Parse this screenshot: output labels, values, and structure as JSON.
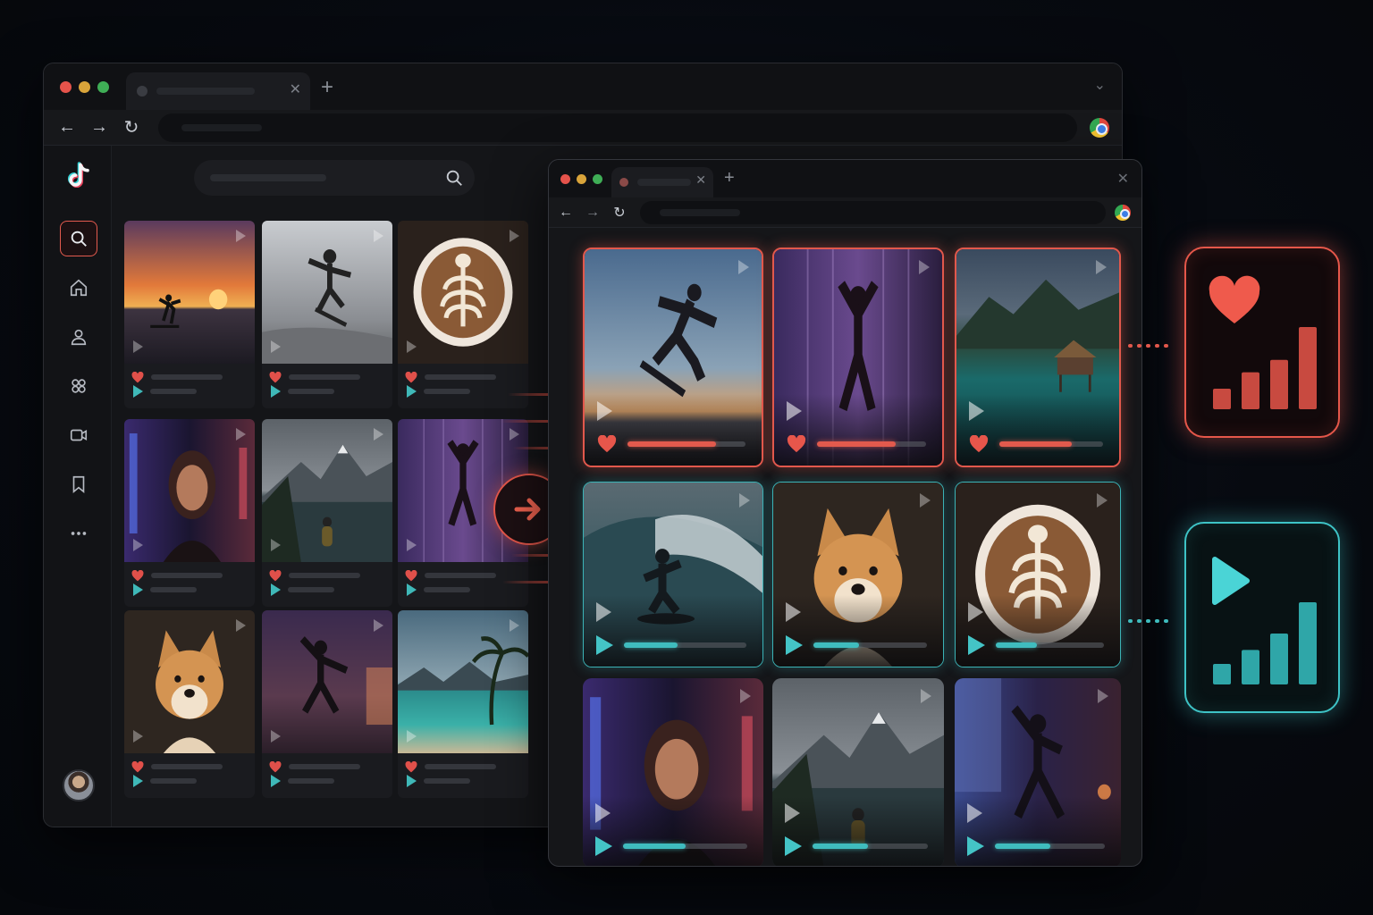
{
  "colors": {
    "accent_red": "#e2584c",
    "accent_teal": "#3fbcbe",
    "background": "#070a10"
  },
  "back_window": {
    "tab": {
      "close_icon": "close-icon",
      "new_tab_icon": "plus-icon"
    },
    "nav": {
      "icons": [
        "back-arrow-icon",
        "forward-arrow-icon",
        "reload-icon",
        "chrome-icon"
      ]
    },
    "app": {
      "logo": "tiktok-logo",
      "sidebar_icons": [
        "search-icon",
        "home-icon",
        "following-icon",
        "friends-icon",
        "live-icon",
        "bookmark-icon",
        "more-icon"
      ],
      "active_sidebar": "search-icon",
      "cards": [
        {
          "subject": "sunset-surfer"
        },
        {
          "subject": "skateboarder"
        },
        {
          "subject": "latte-art"
        },
        {
          "subject": "neon-portrait"
        },
        {
          "subject": "mountain-lake"
        },
        {
          "subject": "dancer-purple"
        },
        {
          "subject": "shiba-dog"
        },
        {
          "subject": "dancer-sunset"
        },
        {
          "subject": "tropical-beach"
        }
      ]
    }
  },
  "front_window": {
    "cards": [
      {
        "subject": "skateboard-jump",
        "style": "red",
        "metric": "likes",
        "progress": 0.75
      },
      {
        "subject": "dancer-purple",
        "style": "red",
        "metric": "likes",
        "progress": 0.72
      },
      {
        "subject": "overwater-bungalow",
        "style": "red",
        "metric": "likes",
        "progress": 0.7
      },
      {
        "subject": "wave-surfer",
        "style": "teal",
        "metric": "plays",
        "progress": 0.44
      },
      {
        "subject": "shiba-dog",
        "style": "teal",
        "metric": "plays",
        "progress": 0.4
      },
      {
        "subject": "latte-art",
        "style": "teal",
        "metric": "plays",
        "progress": 0.38
      },
      {
        "subject": "neon-portrait",
        "style": "plain",
        "metric": "plays",
        "progress": 0.5
      },
      {
        "subject": "mountain-lake",
        "style": "plain",
        "metric": "plays",
        "progress": 0.48
      },
      {
        "subject": "dancer-window",
        "style": "plain",
        "metric": "plays",
        "progress": 0.5
      }
    ]
  },
  "transfer_icon": "arrow-right-icon",
  "panels": [
    {
      "metric": "likes",
      "icon": "heart-icon",
      "bars": [
        0.25,
        0.45,
        0.6,
        1.0
      ]
    },
    {
      "metric": "plays",
      "icon": "play-icon",
      "bars": [
        0.25,
        0.42,
        0.62,
        1.0
      ]
    }
  ]
}
